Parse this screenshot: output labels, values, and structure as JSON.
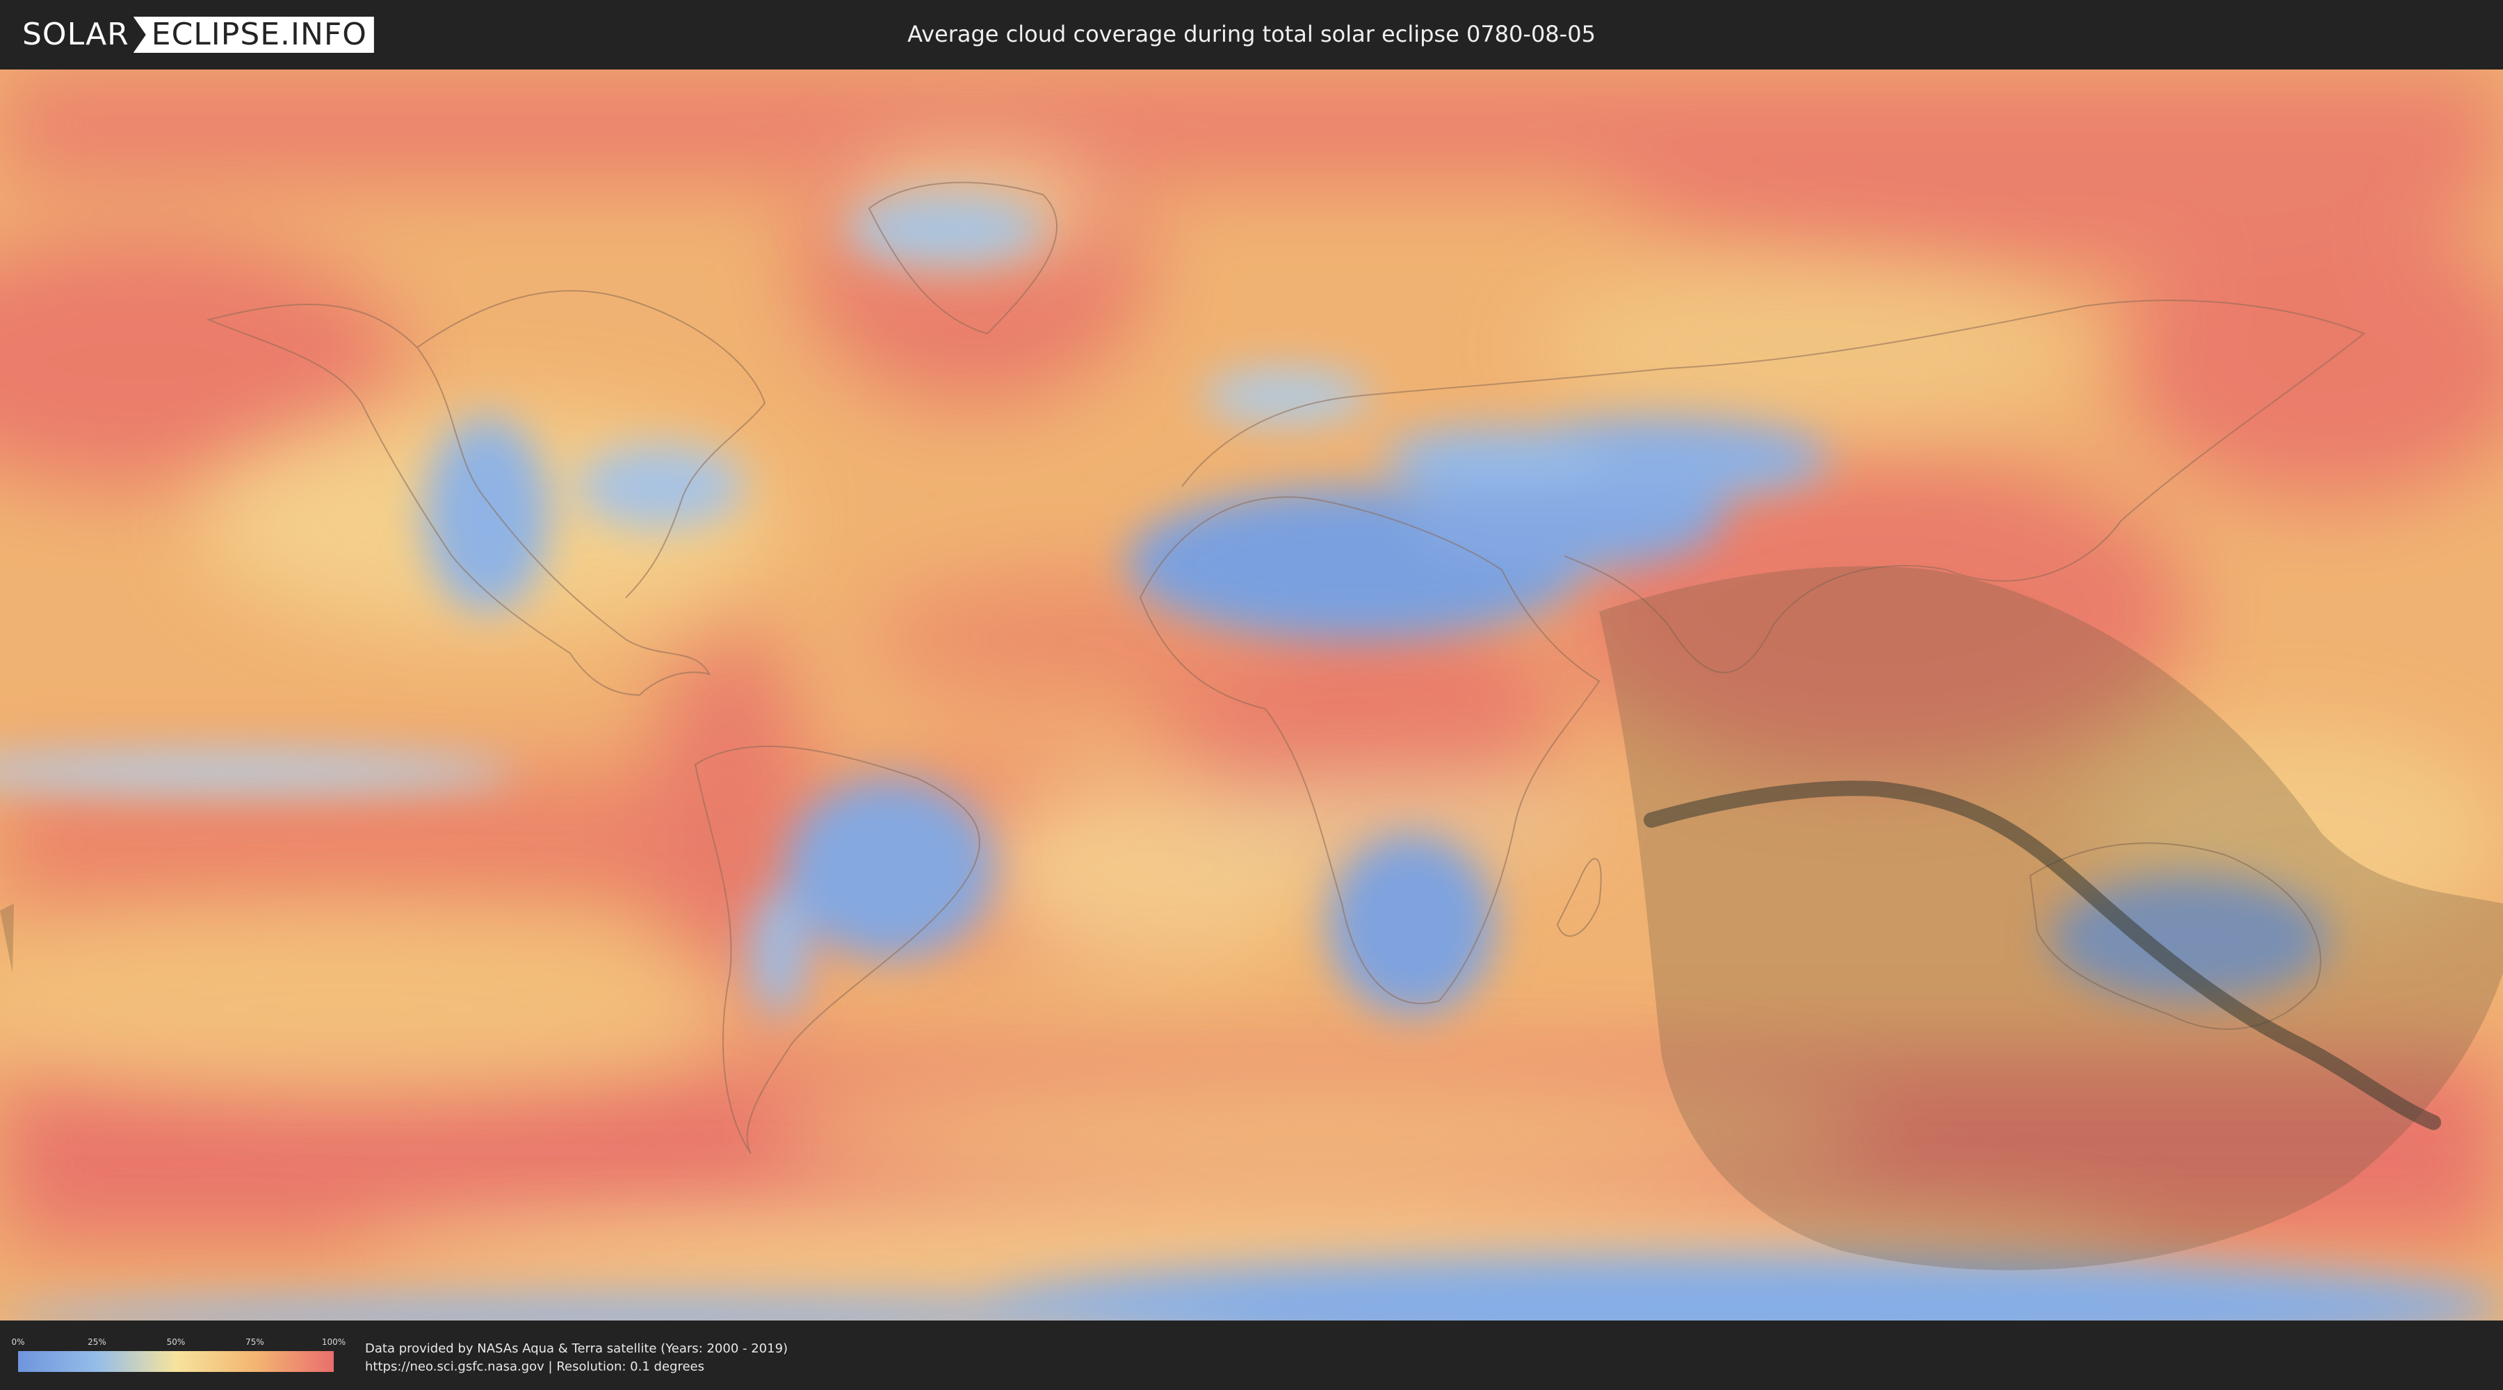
{
  "header": {
    "logo_part1": "SOLAR",
    "logo_part2": "ECLIPSE.INFO",
    "title": "Average cloud coverage during total solar eclipse 0780-08-05"
  },
  "map": {
    "description_icon": "world-cloud-cover-map",
    "colors": {
      "clear": "#6f95dd",
      "low": "#95bde8",
      "mid": "#f6e39d",
      "high": "#f3b671",
      "overcast": "#e96e6e",
      "eclipse_shade": "#6b5a40",
      "central_line": "#3a3a30"
    }
  },
  "legend": {
    "ticks": [
      "0%",
      "25%",
      "50%",
      "75%",
      "100%"
    ],
    "tick_positions": [
      0,
      0.25,
      0.5,
      0.75,
      1.0
    ]
  },
  "credits": {
    "line1": "Data provided by NASAs Aqua & Terra satellite (Years: 2000 - 2019)",
    "line2": "https://neo.sci.gsfc.nasa.gov | Resolution: 0.1 degrees"
  }
}
